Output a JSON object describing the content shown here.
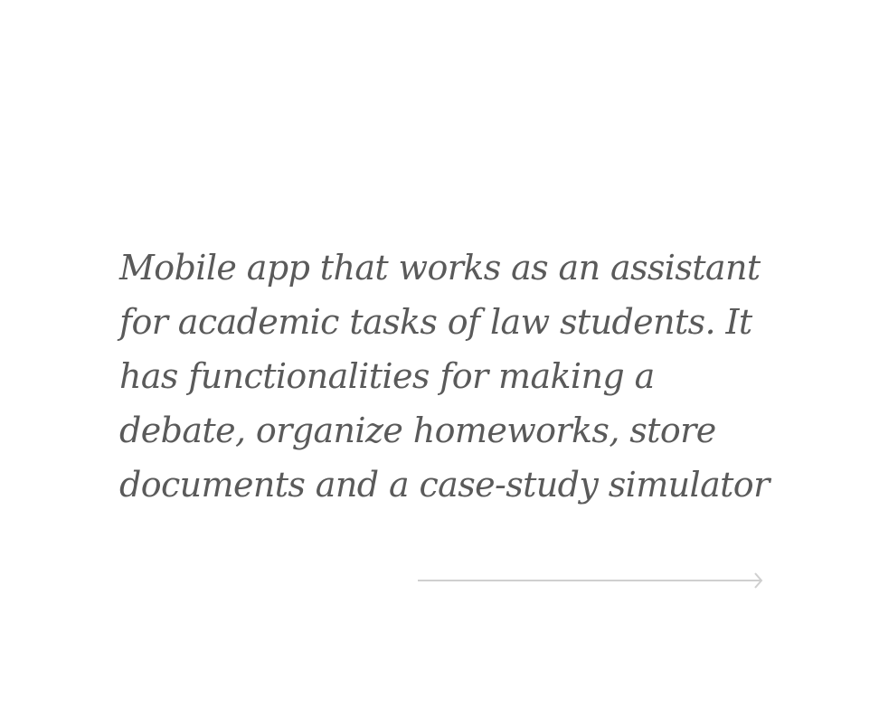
{
  "description": {
    "text": "Mobile app that works as an assistant for academic tasks of law students. It has functionalities for making a debate, organize homeworks, store documents and a case-study simulator"
  },
  "arrow": {
    "icon": "arrow-right-icon",
    "color": "#cfcfcf"
  },
  "colors": {
    "text": "#5a5a5a",
    "background": "#ffffff"
  }
}
